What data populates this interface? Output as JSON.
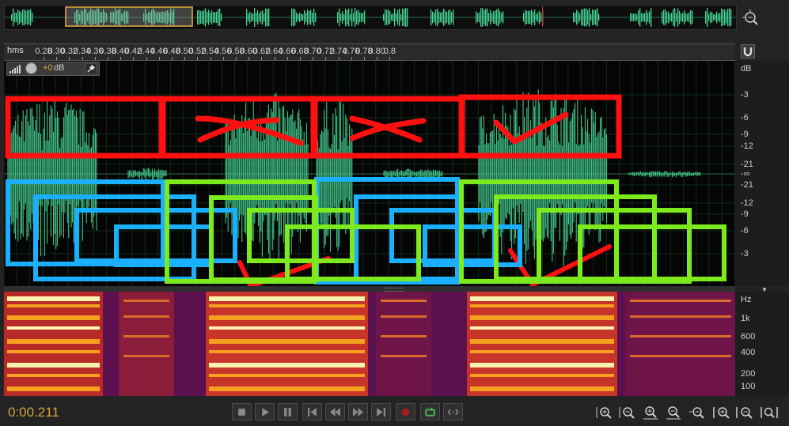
{
  "ruler": {
    "unit": "hms",
    "ticks": [
      "0.28",
      "0.30",
      "0.32",
      "0.34",
      "0.36",
      "0.38",
      "0.40",
      "0.42",
      "0.44",
      "0.46",
      "0.48",
      "0.50",
      "0.52",
      "0.54",
      "0.56",
      "0.58",
      "0.60",
      "0.62",
      "0.64",
      "0.66",
      "0.68",
      "0.70",
      "0.72",
      "0.74",
      "0.76",
      "0.78",
      "0.80",
      "0.8"
    ]
  },
  "hud": {
    "gain_value": "+0",
    "gain_unit": "dB"
  },
  "db_scale": {
    "unit": "dB",
    "labels": [
      "-3",
      "-6",
      "-9",
      "-12",
      "-21",
      "-∞",
      "-21",
      "-12",
      "-9",
      "-6",
      "-3"
    ]
  },
  "hz_scale": {
    "unit": "Hz",
    "labels": [
      "1k",
      "600",
      "400",
      "200",
      "100"
    ]
  },
  "transport": {
    "time": "0:00.211",
    "buttons": [
      "stop-icon",
      "play-icon",
      "pause-icon",
      "skip-start-icon",
      "rewind-icon",
      "fast-forward-icon",
      "skip-end-icon",
      "record-icon",
      "loop-icon",
      "skip-selection-icon"
    ]
  },
  "zoom_buttons": [
    "zoom-in-amplitude-icon",
    "zoom-out-amplitude-icon",
    "zoom-in-time-icon",
    "zoom-out-time-icon",
    "zoom-reset-icon",
    "zoom-in-point-icon",
    "zoom-out-point-icon",
    "zoom-full-icon"
  ],
  "colors": {
    "waveform": "#46d494",
    "annotation_red": "#ff1010",
    "annotation_blue": "#1ab0ff",
    "annotation_green": "#7cea1c",
    "accent": "#d4a43a",
    "playhead": "#d23b2b"
  }
}
